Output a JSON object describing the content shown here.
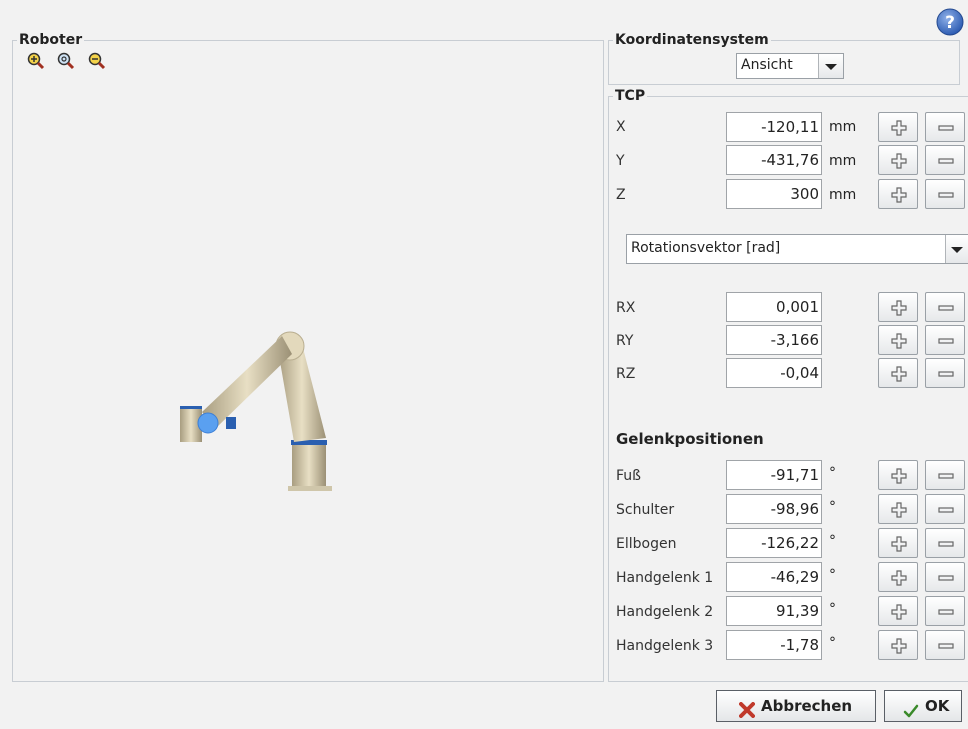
{
  "robot_panel": {
    "title": "Roboter",
    "zoom_icons": [
      "zoom-in-icon",
      "zoom-reset-icon",
      "zoom-out-icon"
    ]
  },
  "coord_panel": {
    "title": "Koordinatensystem",
    "view_select": "Ansicht"
  },
  "tcp": {
    "title": "TCP",
    "x": {
      "label": "X",
      "value": "-120,11",
      "unit": "mm"
    },
    "y": {
      "label": "Y",
      "value": "-431,76",
      "unit": "mm"
    },
    "z": {
      "label": "Z",
      "value": "300",
      "unit": "mm"
    },
    "rotation_select": "Rotationsvektor [rad]",
    "rx": {
      "label": "RX",
      "value": "0,001"
    },
    "ry": {
      "label": "RY",
      "value": "-3,166"
    },
    "rz": {
      "label": "RZ",
      "value": "-0,04"
    }
  },
  "joints": {
    "title": "Gelenkpositionen",
    "unit": "°",
    "items": [
      {
        "label": "Fuß",
        "value": "-91,71"
      },
      {
        "label": "Schulter",
        "value": "-98,96"
      },
      {
        "label": "Ellbogen",
        "value": "-126,22"
      },
      {
        "label": "Handgelenk 1",
        "value": "-46,29"
      },
      {
        "label": "Handgelenk 2",
        "value": "91,39"
      },
      {
        "label": "Handgelenk 3",
        "value": "-1,78"
      }
    ]
  },
  "dialog": {
    "cancel_label": "Abbrechen",
    "ok_label": "OK"
  },
  "colors": {
    "accent_blue": "#3b6fc4",
    "robot_body": "#d8cdb0",
    "robot_ring": "#2a5fb0",
    "help_icon": "#3d6cc0"
  }
}
